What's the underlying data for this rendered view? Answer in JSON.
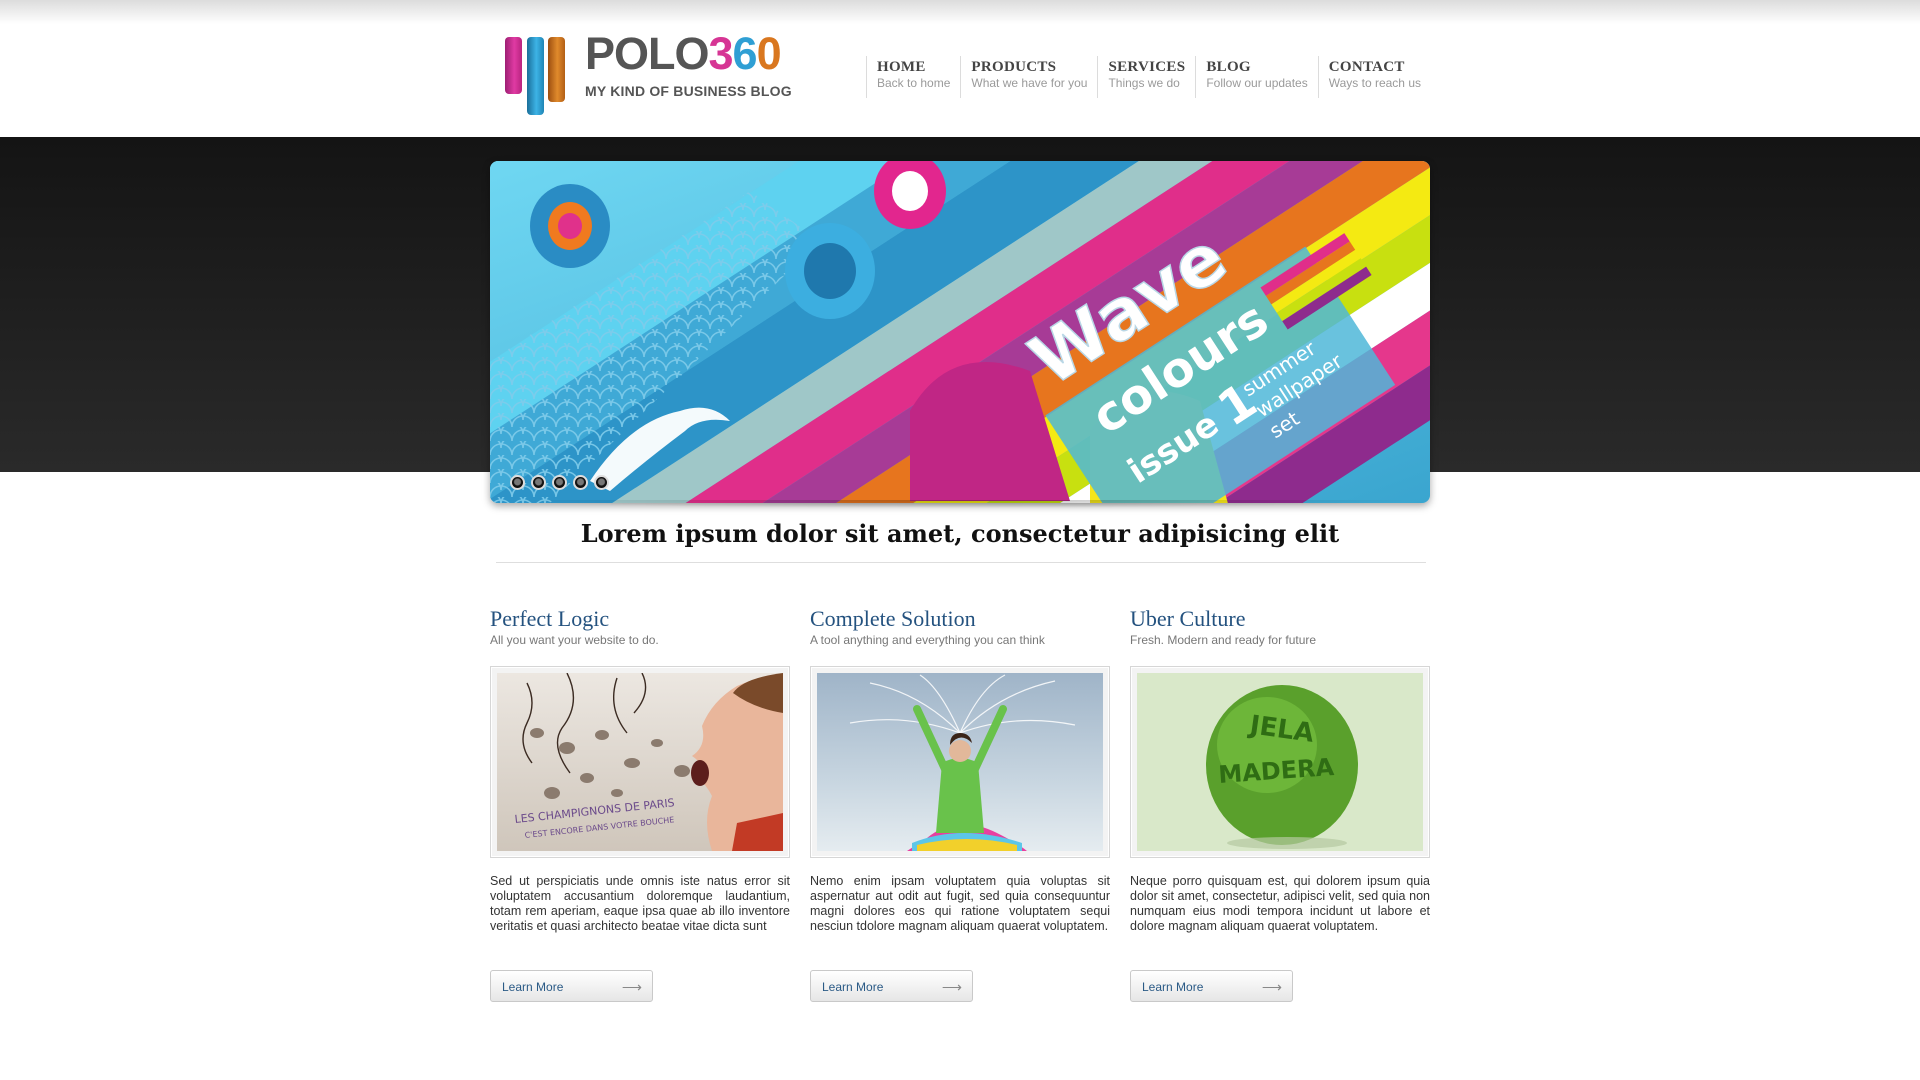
{
  "site": {
    "logo_name_prefix": "POLO",
    "logo_digit_1": "3",
    "logo_digit_2": "6",
    "logo_digit_3": "0",
    "logo_tagline": "MY KIND OF BUSINESS BLOG",
    "brand_colors": [
      "#d63594",
      "#2f9fd4",
      "#d9771f"
    ]
  },
  "nav": {
    "items": [
      {
        "label": "HOME",
        "sub": "Back to home"
      },
      {
        "label": "PRODUCTS",
        "sub": "What we have for you"
      },
      {
        "label": "SERVICES",
        "sub": "Things we do"
      },
      {
        "label": "BLOG",
        "sub": "Follow our updates"
      },
      {
        "label": "CONTACT",
        "sub": "Ways to reach us"
      }
    ]
  },
  "slider": {
    "dot_count": 5,
    "title_word_1": "Wave",
    "title_word_2": "colours",
    "issue": "issue",
    "issue_number": "1",
    "caption_1": "summer",
    "caption_2": "wallpaper",
    "caption_3": "set"
  },
  "headline": "Lorem ipsum dolor sit amet, consectetur adipisicing elit",
  "features": [
    {
      "title": "Perfect Logic",
      "subtitle": "All you want your website to do.",
      "image_caption_1": "LES CHAMPIGNONS DE PARIS",
      "image_caption_2": "C'EST ENCORE DANS VOTRE BOUCHE",
      "text": "Sed ut perspiciatis unde omnis iste natus error sit voluptatem accusantium doloremque laudantium, totam rem aperiam, eaque ipsa quae ab illo inventore veritatis et quasi architecto beatae vitae dicta sunt",
      "button": "Learn More"
    },
    {
      "title": "Complete Solution",
      "subtitle": "A tool anything and everything you can think",
      "text": "Nemo enim ipsam voluptatem quia voluptas sit aspernatur aut odit aut fugit, sed quia consequuntur magni dolores eos qui ratione voluptatem sequi nesciun tdolore magnam aliquam quaerat voluptatem.",
      "button": "Learn More"
    },
    {
      "title": "Uber Culture",
      "subtitle": "Fresh. Modern and ready for future",
      "image_text_1": "JELA",
      "image_text_2": "MADERA",
      "text": "Neque porro quisquam est, qui dolorem ipsum quia dolor sit amet, consectetur, adipisci velit, sed quia non numquam eius modi tempora incidunt ut labore et dolore magnam aliquam quaerat voluptatem.",
      "button": "Learn More"
    }
  ]
}
